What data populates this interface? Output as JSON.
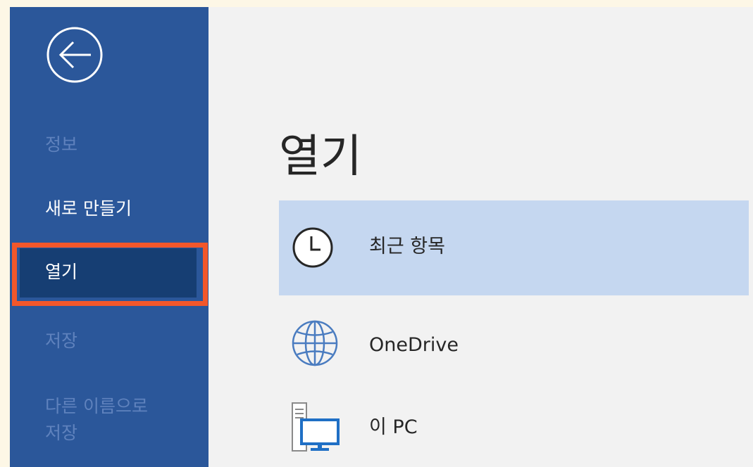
{
  "backstage": {
    "back_icon": "back-arrow-circle-icon",
    "nav": {
      "info": "정보",
      "new": "새로 만들기",
      "open": "열기",
      "save": "저장",
      "save_as_line1": "다른 이름으로",
      "save_as_line2": "저장"
    }
  },
  "main": {
    "title": "열기",
    "locations": [
      {
        "label": "최근 항목",
        "icon": "clock-icon",
        "selected": true
      },
      {
        "label": "OneDrive",
        "icon": "globe-icon",
        "selected": false
      },
      {
        "label": "이 PC",
        "icon": "computer-icon",
        "selected": false
      }
    ]
  },
  "colors": {
    "sidebar": "#2b579a",
    "sidebar_selected": "#163e73",
    "highlight_border": "#f2572b",
    "selected_location": "#c5d7f0",
    "disabled_text": "#5f82bd",
    "page_bg": "#fdf7e6",
    "content_bg": "#f2f2f2"
  }
}
